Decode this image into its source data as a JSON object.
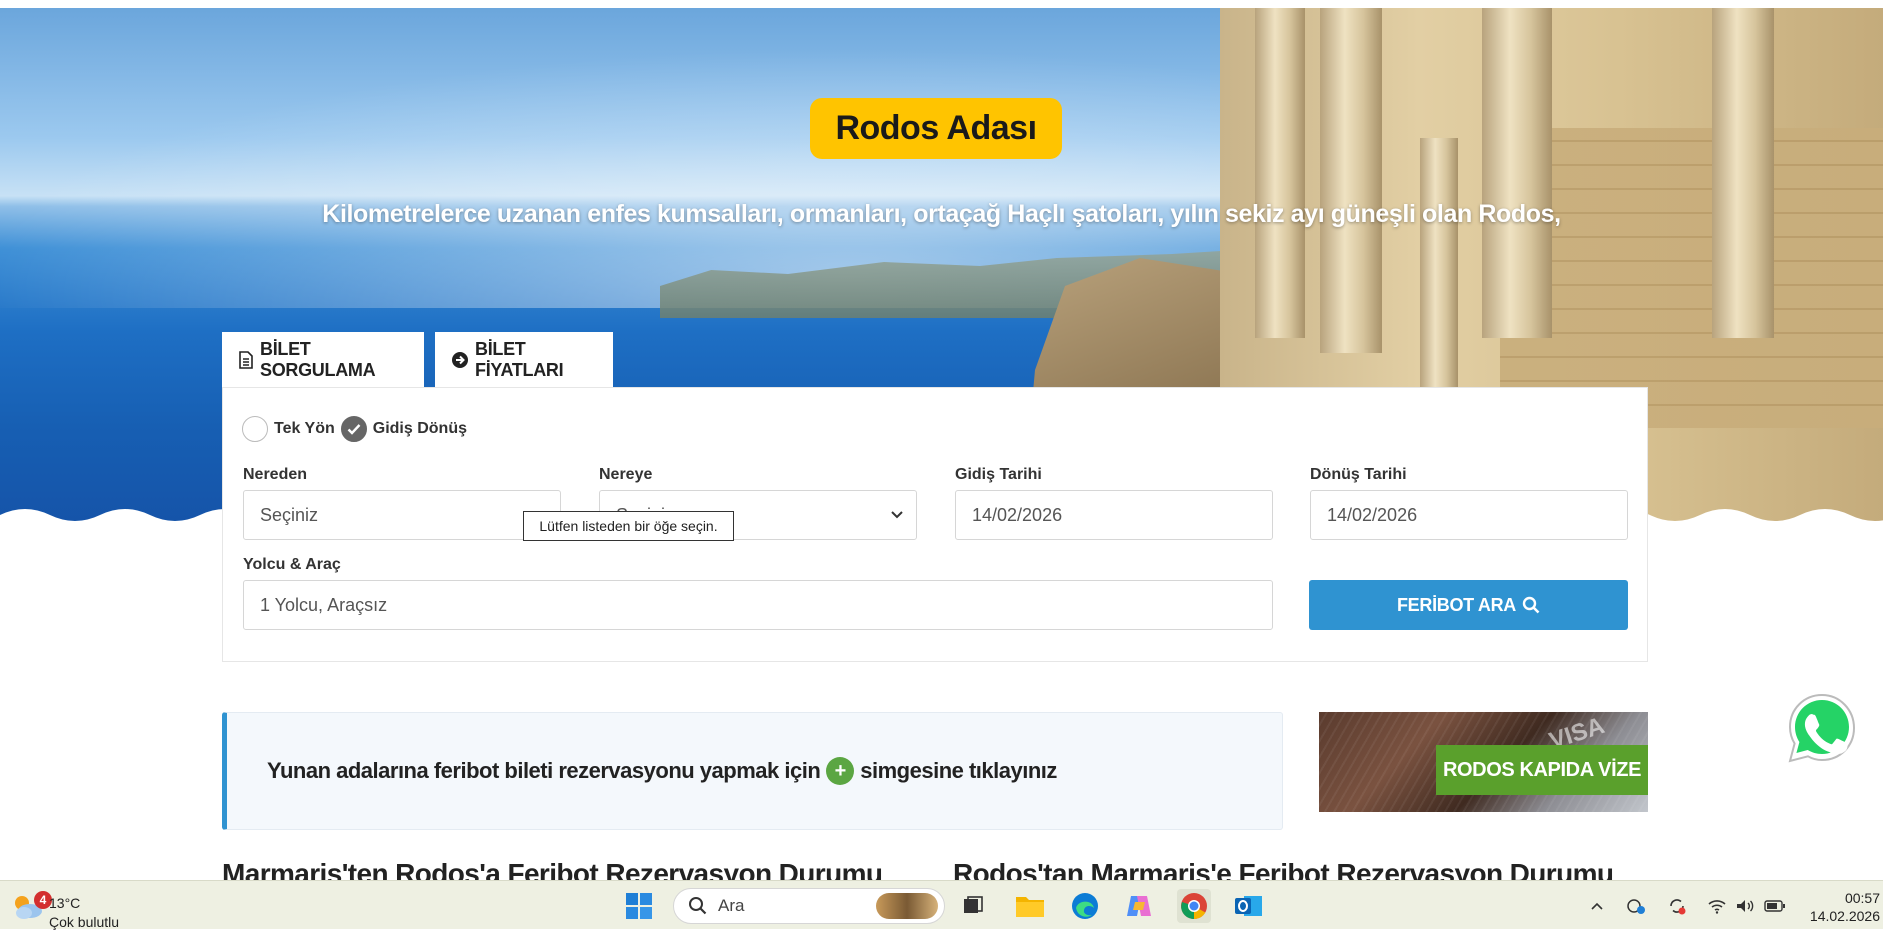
{
  "hero": {
    "title": "Rodos Adası",
    "subtitle": "Kilometrelerce uzanan enfes kumsalları, ormanları, ortaçağ Haçlı şatoları, yılın sekiz ayı güneşli olan Rodos,"
  },
  "tabs": [
    {
      "label": "BİLET SORGULAMA",
      "icon": "document-icon"
    },
    {
      "label": "BİLET FİYATLARI",
      "icon": "arrow-circle-right-icon"
    }
  ],
  "form": {
    "trip_types": [
      {
        "label": "Tek Yön",
        "checked": false
      },
      {
        "label": "Gidiş Dönüş",
        "checked": true
      }
    ],
    "from": {
      "label": "Nereden",
      "value": "Seçiniz"
    },
    "to": {
      "label": "Nereye",
      "value": "Seçiniz"
    },
    "depart": {
      "label": "Gidiş Tarihi",
      "value": "14/02/2026"
    },
    "return": {
      "label": "Dönüş Tarihi",
      "value": "14/02/2026"
    },
    "passengers": {
      "label": "Yolcu & Araç",
      "value": "1 Yolcu, Araçsız"
    },
    "tooltip": "Lütfen listeden bir öğe seçin.",
    "search_button": "FERİBOT ARA"
  },
  "info": {
    "text_before": "Yunan adalarına feribot bileti rezervasyonu yapmak için",
    "text_after": "simgesine tıklayınız"
  },
  "visa": {
    "banner": "RODOS KAPIDA VİZE",
    "stamp": "VISA"
  },
  "headings": [
    "Marmaris'ten Rodos'a Feribot Rezervasyon Durumu",
    "Rodos'tan Marmaris'e Feribot Rezervasyon Durumu"
  ],
  "taskbar": {
    "weather_temp": "13°C",
    "weather_desc": "Çok bulutlu",
    "notification_count": "4",
    "search_placeholder": "Ara",
    "time": "00:57",
    "date": "14.02.2026"
  }
}
